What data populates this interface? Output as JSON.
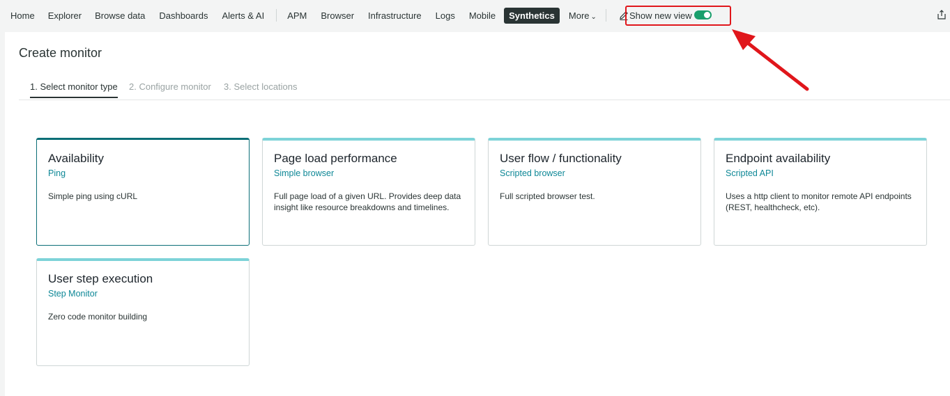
{
  "nav": {
    "items": [
      "Home",
      "Explorer",
      "Browse data",
      "Dashboards",
      "Alerts & AI"
    ],
    "items2": [
      "APM",
      "Browser",
      "Infrastructure",
      "Logs",
      "Mobile"
    ],
    "active": "Synthetics",
    "more": "More"
  },
  "toggle": {
    "label": "Show new view",
    "state": "on",
    "color": "#1a9f6c"
  },
  "page": {
    "title": "Create monitor",
    "tabs": [
      "1. Select monitor type",
      "2. Configure monitor",
      "3. Select locations"
    ]
  },
  "cards": [
    {
      "title": "Availability",
      "subtitle": "Ping",
      "description": "Simple ping using cURL"
    },
    {
      "title": "Page load performance",
      "subtitle": "Simple browser",
      "description": "Full page load of a given URL. Provides deep data insight like resource breakdowns and timelines."
    },
    {
      "title": "User flow / functionality",
      "subtitle": "Scripted browser",
      "description": "Full scripted browser test."
    },
    {
      "title": "Endpoint availability",
      "subtitle": "Scripted API",
      "description": "Uses a http client to monitor remote API endpoints (REST, healthcheck, etc)."
    },
    {
      "title": "User step execution",
      "subtitle": "Step Monitor",
      "description": "Zero code monitor building"
    }
  ],
  "colors": {
    "accent": "#0d8796",
    "selected_border": "#0b6e77",
    "card_top": "#7dd3d8",
    "annotation": "#e0161b"
  }
}
